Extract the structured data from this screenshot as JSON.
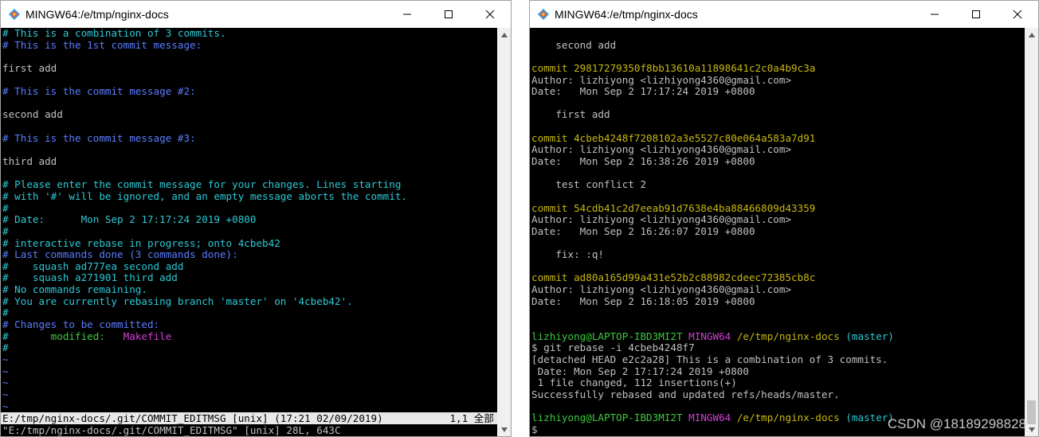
{
  "left_window": {
    "title": "MINGW64:/e/tmp/nginx-docs",
    "lines": [
      {
        "segs": [
          {
            "t": "# This is a combination of 3 commits.",
            "c": "cyan"
          }
        ]
      },
      {
        "segs": [
          {
            "t": "# This is the 1st commit message:",
            "c": "blue"
          }
        ]
      },
      {
        "segs": [
          {
            "t": "",
            "c": "white"
          }
        ]
      },
      {
        "segs": [
          {
            "t": "first add",
            "c": "white"
          }
        ]
      },
      {
        "segs": [
          {
            "t": "",
            "c": "white"
          }
        ]
      },
      {
        "segs": [
          {
            "t": "# This is the commit message #2:",
            "c": "blue"
          }
        ]
      },
      {
        "segs": [
          {
            "t": "",
            "c": "white"
          }
        ]
      },
      {
        "segs": [
          {
            "t": "second add",
            "c": "white"
          }
        ]
      },
      {
        "segs": [
          {
            "t": "",
            "c": "white"
          }
        ]
      },
      {
        "segs": [
          {
            "t": "# This is the commit message #3:",
            "c": "blue"
          }
        ]
      },
      {
        "segs": [
          {
            "t": "",
            "c": "white"
          }
        ]
      },
      {
        "segs": [
          {
            "t": "third add",
            "c": "white"
          }
        ]
      },
      {
        "segs": [
          {
            "t": "",
            "c": "white"
          }
        ]
      },
      {
        "segs": [
          {
            "t": "# Please enter the commit message for your changes. Lines starting",
            "c": "cyan"
          }
        ]
      },
      {
        "segs": [
          {
            "t": "# with '#' will be ignored, and an empty message aborts the commit.",
            "c": "cyan"
          }
        ]
      },
      {
        "segs": [
          {
            "t": "#",
            "c": "cyan"
          }
        ]
      },
      {
        "segs": [
          {
            "t": "# Date:      Mon Sep 2 17:17:24 2019 +0800",
            "c": "cyan"
          }
        ]
      },
      {
        "segs": [
          {
            "t": "#",
            "c": "cyan"
          }
        ]
      },
      {
        "segs": [
          {
            "t": "# interactive rebase in progress; onto 4cbeb42",
            "c": "cyan"
          }
        ]
      },
      {
        "segs": [
          {
            "t": "# Last commands done (3 commands done):",
            "c": "blue"
          }
        ]
      },
      {
        "segs": [
          {
            "t": "#    squash ad777ea second add",
            "c": "cyan"
          }
        ]
      },
      {
        "segs": [
          {
            "t": "#    squash a271901 third add",
            "c": "cyan"
          }
        ]
      },
      {
        "segs": [
          {
            "t": "# No commands remaining.",
            "c": "cyan"
          }
        ]
      },
      {
        "segs": [
          {
            "t": "# You are currently rebasing branch 'master' on '4cbeb42'.",
            "c": "cyan"
          }
        ]
      },
      {
        "segs": [
          {
            "t": "#",
            "c": "cyan"
          }
        ]
      },
      {
        "segs": [
          {
            "t": "# Changes to be committed:",
            "c": "blue"
          }
        ]
      },
      {
        "segs": [
          {
            "t": "#       ",
            "c": "cyan"
          },
          {
            "t": "modified:",
            "c": "green"
          },
          {
            "t": "   ",
            "c": "white"
          },
          {
            "t": "Makefile",
            "c": "magenta"
          }
        ]
      },
      {
        "segs": [
          {
            "t": "#",
            "c": "cyan"
          }
        ]
      },
      {
        "segs": [
          {
            "t": "~",
            "c": "tilde"
          }
        ]
      },
      {
        "segs": [
          {
            "t": "~",
            "c": "tilde"
          }
        ]
      },
      {
        "segs": [
          {
            "t": "~",
            "c": "tilde"
          }
        ]
      },
      {
        "segs": [
          {
            "t": "~",
            "c": "tilde"
          }
        ]
      },
      {
        "segs": [
          {
            "t": "~",
            "c": "tilde"
          }
        ]
      }
    ],
    "status_line": "E:/tmp/nginx-docs/.git/COMMIT_EDITMSG [unix] (17:21 02/09/2019)",
    "status_pos": "1,1 全部",
    "message_line": "\"E:/tmp/nginx-docs/.git/COMMIT_EDITMSG\" [unix] 28L, 643C"
  },
  "right_window": {
    "title": "MINGW64:/e/tmp/nginx-docs",
    "lines": [
      {
        "segs": [
          {
            "t": "",
            "c": "white"
          }
        ]
      },
      {
        "segs": [
          {
            "t": "    second add",
            "c": "white"
          }
        ]
      },
      {
        "segs": [
          {
            "t": "",
            "c": "white"
          }
        ]
      },
      {
        "segs": [
          {
            "t": "commit 29817279350f8bb13610a11898641c2c0a4b9c3a",
            "c": "yellow"
          }
        ]
      },
      {
        "segs": [
          {
            "t": "Author: lizhiyong <lizhiyong4360@gmail.com>",
            "c": "white"
          }
        ]
      },
      {
        "segs": [
          {
            "t": "Date:   Mon Sep 2 17:17:24 2019 +0800",
            "c": "white"
          }
        ]
      },
      {
        "segs": [
          {
            "t": "",
            "c": "white"
          }
        ]
      },
      {
        "segs": [
          {
            "t": "    first add",
            "c": "white"
          }
        ]
      },
      {
        "segs": [
          {
            "t": "",
            "c": "white"
          }
        ]
      },
      {
        "segs": [
          {
            "t": "commit 4cbeb4248f7208102a3e5527c80e064a583a7d91",
            "c": "yellow"
          }
        ]
      },
      {
        "segs": [
          {
            "t": "Author: lizhiyong <lizhiyong4360@gmail.com>",
            "c": "white"
          }
        ]
      },
      {
        "segs": [
          {
            "t": "Date:   Mon Sep 2 16:38:26 2019 +0800",
            "c": "white"
          }
        ]
      },
      {
        "segs": [
          {
            "t": "",
            "c": "white"
          }
        ]
      },
      {
        "segs": [
          {
            "t": "    test conflict 2",
            "c": "white"
          }
        ]
      },
      {
        "segs": [
          {
            "t": "",
            "c": "white"
          }
        ]
      },
      {
        "segs": [
          {
            "t": "commit 54cdb41c2d7eeab91d7638e4ba88466809d43359",
            "c": "yellow"
          }
        ]
      },
      {
        "segs": [
          {
            "t": "Author: lizhiyong <lizhiyong4360@gmail.com>",
            "c": "white"
          }
        ]
      },
      {
        "segs": [
          {
            "t": "Date:   Mon Sep 2 16:26:07 2019 +0800",
            "c": "white"
          }
        ]
      },
      {
        "segs": [
          {
            "t": "",
            "c": "white"
          }
        ]
      },
      {
        "segs": [
          {
            "t": "    fix: :q!",
            "c": "white"
          }
        ]
      },
      {
        "segs": [
          {
            "t": "",
            "c": "white"
          }
        ]
      },
      {
        "segs": [
          {
            "t": "commit ad80a165d99a431e52b2c88982cdeec72385cb8c",
            "c": "yellow"
          }
        ]
      },
      {
        "segs": [
          {
            "t": "Author: lizhiyong <lizhiyong4360@gmail.com>",
            "c": "white"
          }
        ]
      },
      {
        "segs": [
          {
            "t": "Date:   Mon Sep 2 16:18:05 2019 +0800",
            "c": "white"
          }
        ]
      },
      {
        "segs": [
          {
            "t": "",
            "c": "white"
          }
        ]
      },
      {
        "segs": [
          {
            "t": "",
            "c": "white"
          }
        ]
      },
      {
        "segs": [
          {
            "t": "lizhiyong@LAPTOP-IBD3MI2T",
            "c": "green"
          },
          {
            "t": " ",
            "c": "white"
          },
          {
            "t": "MINGW64",
            "c": "magenta"
          },
          {
            "t": " ",
            "c": "white"
          },
          {
            "t": "/e/tmp/nginx-docs",
            "c": "yellow"
          },
          {
            "t": " ",
            "c": "white"
          },
          {
            "t": "(master)",
            "c": "cyan"
          }
        ]
      },
      {
        "segs": [
          {
            "t": "$ git rebase -i 4cbeb4248f7",
            "c": "white"
          }
        ]
      },
      {
        "segs": [
          {
            "t": "[detached HEAD e2c2a28] This is a combination of 3 commits.",
            "c": "white"
          }
        ]
      },
      {
        "segs": [
          {
            "t": " Date: Mon Sep 2 17:17:24 2019 +0800",
            "c": "white"
          }
        ]
      },
      {
        "segs": [
          {
            "t": " 1 file changed, 112 insertions(+)",
            "c": "white"
          }
        ]
      },
      {
        "segs": [
          {
            "t": "Successfully rebased and updated refs/heads/master.",
            "c": "white"
          }
        ]
      },
      {
        "segs": [
          {
            "t": "",
            "c": "white"
          }
        ]
      },
      {
        "segs": [
          {
            "t": "lizhiyong@LAPTOP-IBD3MI2T",
            "c": "green"
          },
          {
            "t": " ",
            "c": "white"
          },
          {
            "t": "MINGW64",
            "c": "magenta"
          },
          {
            "t": " ",
            "c": "white"
          },
          {
            "t": "/e/tmp/nginx-docs",
            "c": "yellow"
          },
          {
            "t": " ",
            "c": "white"
          },
          {
            "t": "(master)",
            "c": "cyan"
          }
        ]
      },
      {
        "segs": [
          {
            "t": "$",
            "c": "white"
          }
        ]
      }
    ]
  },
  "watermark": "CSDN @18189298828",
  "icons": {
    "app": "git-bash-icon",
    "minimize": "minimize-icon",
    "maximize": "maximize-icon",
    "close": "close-icon"
  }
}
